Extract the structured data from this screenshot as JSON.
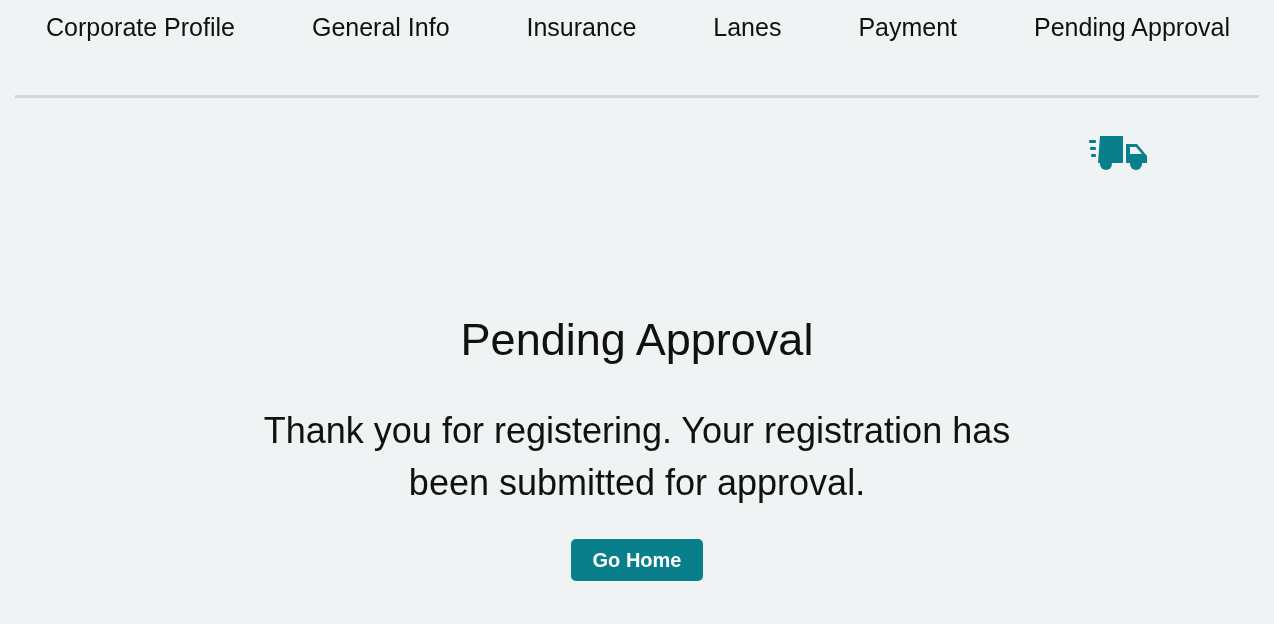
{
  "tabs": [
    {
      "label": "Corporate Profile"
    },
    {
      "label": "General Info"
    },
    {
      "label": "Insurance"
    },
    {
      "label": "Lanes"
    },
    {
      "label": "Payment"
    },
    {
      "label": "Pending Approval"
    }
  ],
  "title": "Pending Approval",
  "message": "Thank you for registering. Your registration has been submitted for approval.",
  "button": "Go Home"
}
